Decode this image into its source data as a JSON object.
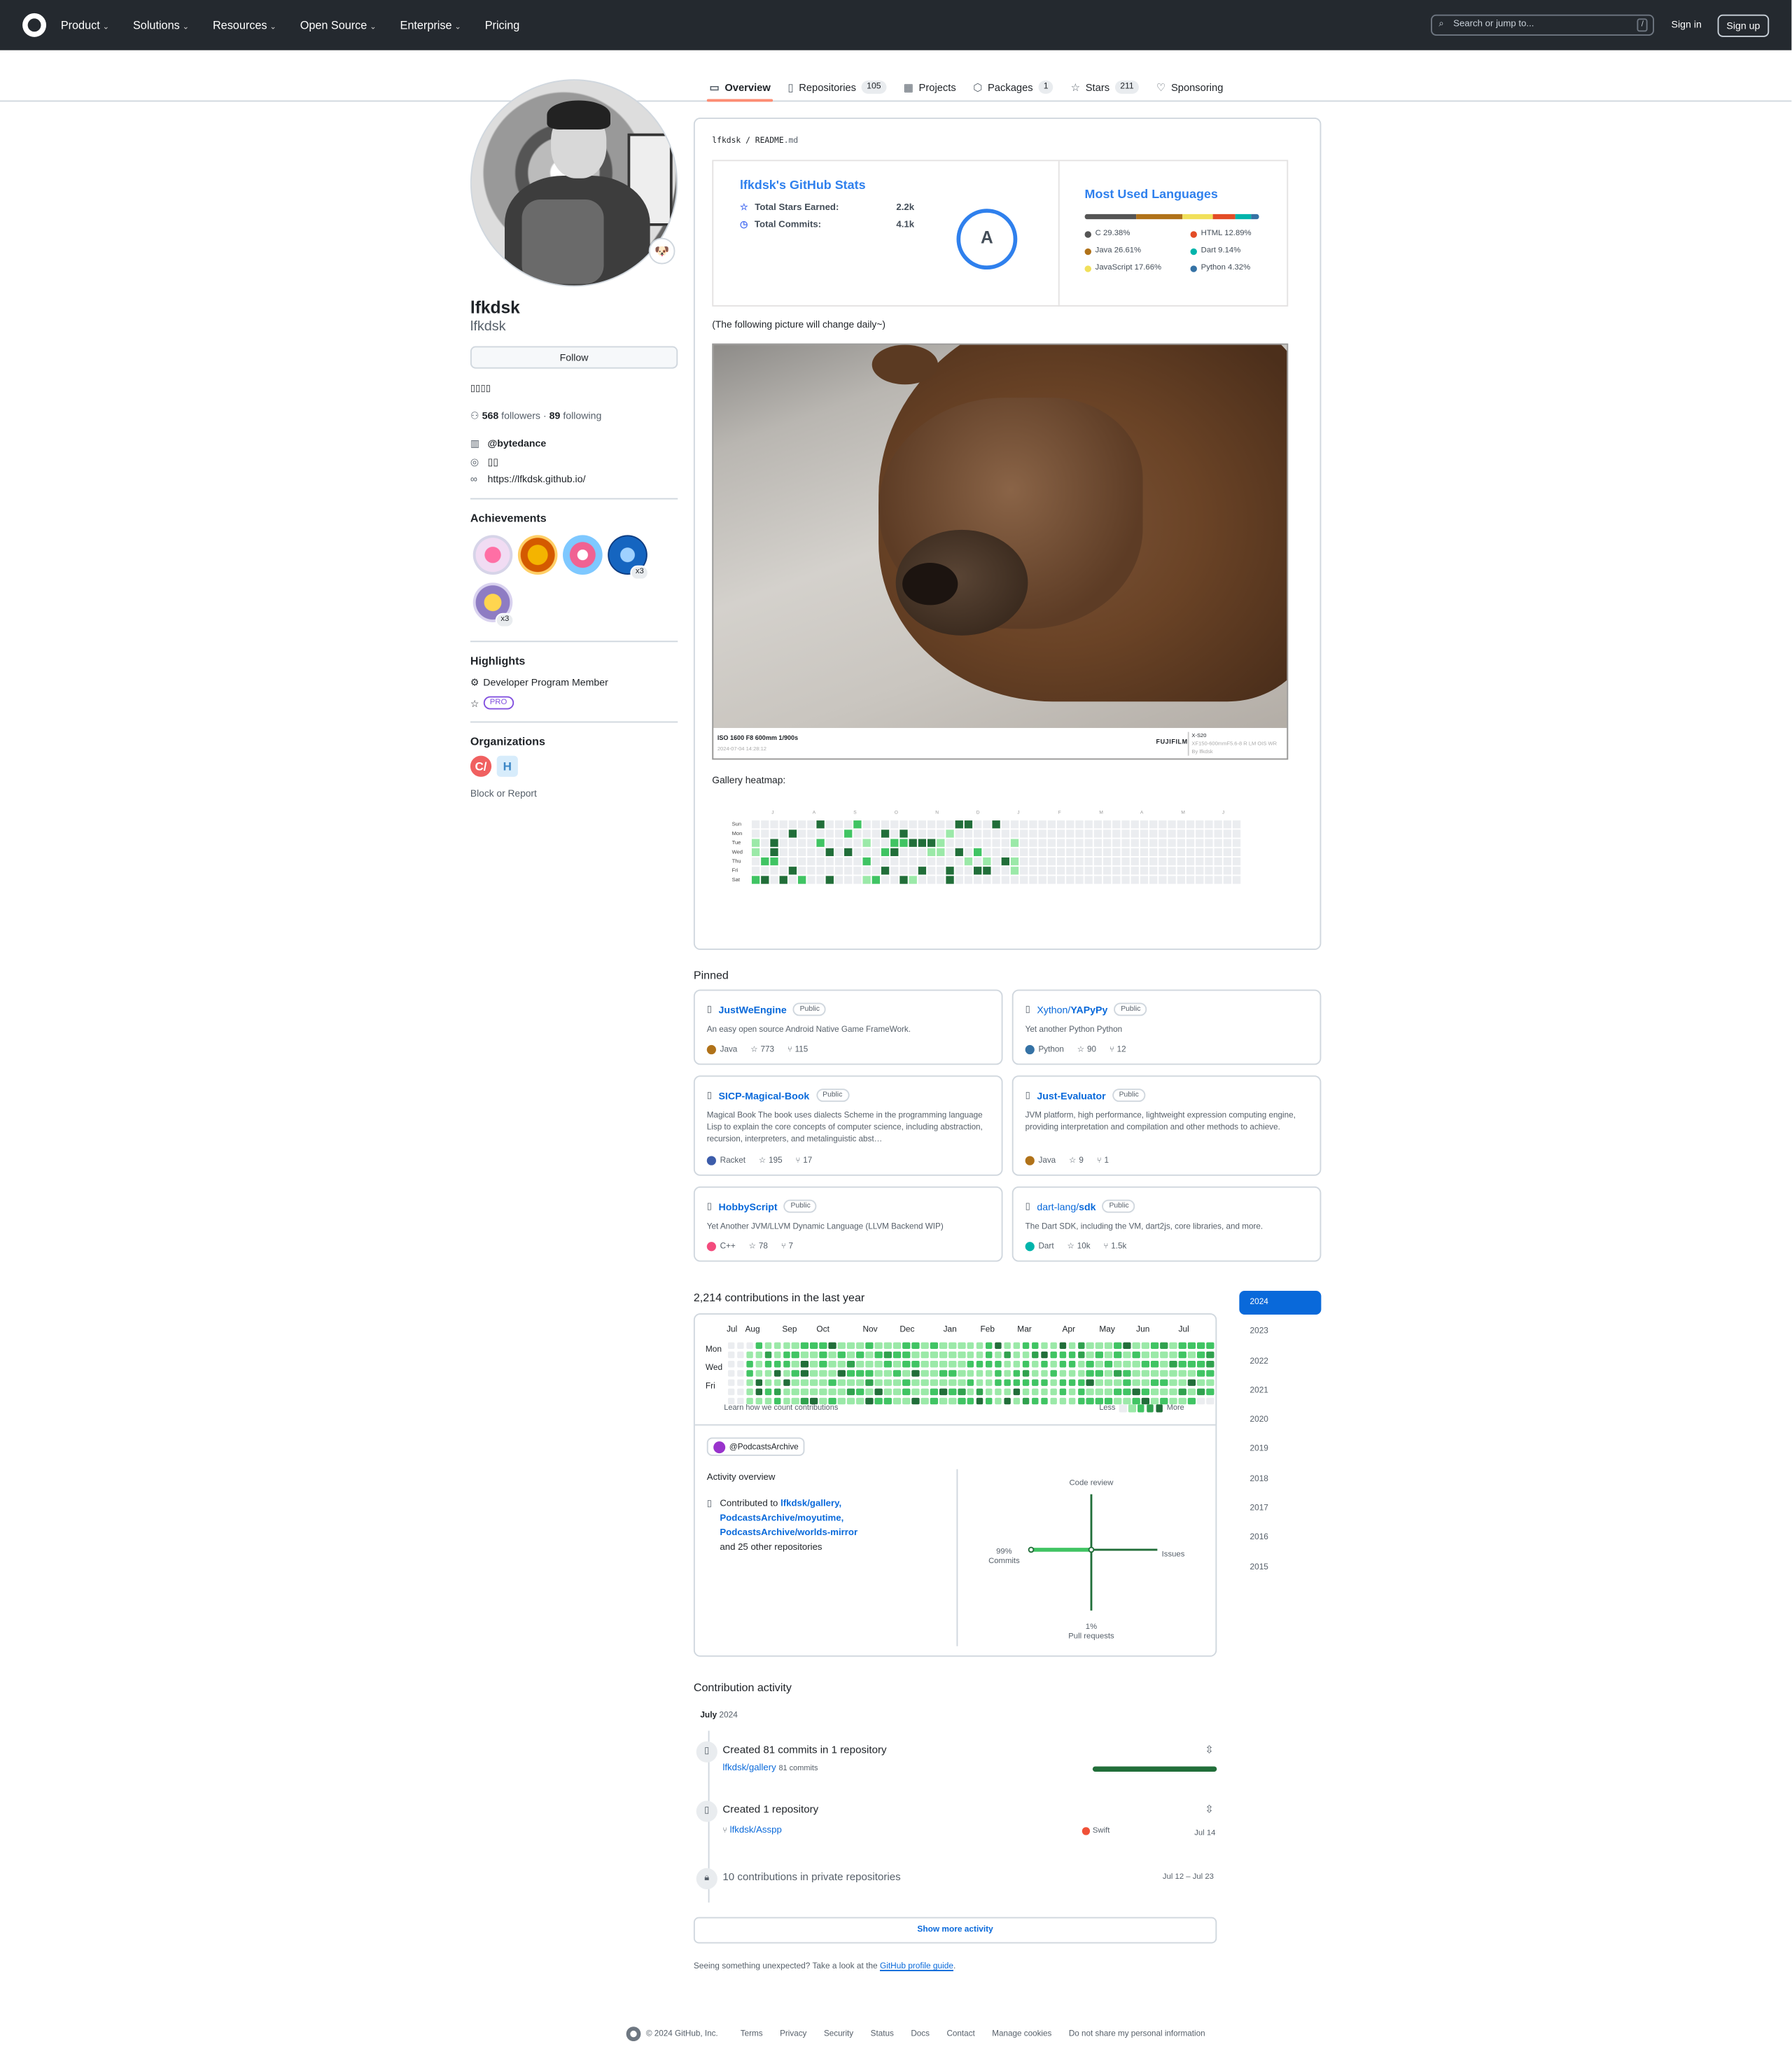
{
  "header": {
    "nav": [
      "Product",
      "Solutions",
      "Resources",
      "Open Source",
      "Enterprise",
      "Pricing"
    ],
    "search_placeholder": "Search or jump to...",
    "search_key": "/",
    "signin": "Sign in",
    "signup": "Sign up"
  },
  "tabs": [
    {
      "label": "Overview",
      "count": "",
      "icon": "book-icon"
    },
    {
      "label": "Repositories",
      "count": "105",
      "icon": "repo-icon"
    },
    {
      "label": "Projects",
      "count": "",
      "icon": "table-icon"
    },
    {
      "label": "Packages",
      "count": "1",
      "icon": "package-icon"
    },
    {
      "label": "Stars",
      "count": "211",
      "icon": "star-icon"
    },
    {
      "label": "Sponsoring",
      "count": "",
      "icon": "heart-icon"
    }
  ],
  "profile": {
    "name": "lfkdsk",
    "login": "lfkdsk",
    "follow": "Follow",
    "bio": "▯▯▯▯",
    "followers": "568",
    "followers_label": "followers",
    "sep": "·",
    "following": "89",
    "following_label": "following",
    "company": "@bytedance",
    "location": "▯▯",
    "website": "https://lfkdsk.github.io/",
    "status_emoji": "🐶"
  },
  "sidebar": {
    "achievements_title": "Achievements",
    "badge_counts": [
      "x3",
      "x3"
    ],
    "highlights_title": "Highlights",
    "highlight_member": "Developer Program Member",
    "highlight_pro": "PRO",
    "orgs_title": "Organizations",
    "orgs": [
      "C/",
      "H"
    ],
    "block": "Block or Report"
  },
  "readme": {
    "path_user": "lfkdsk",
    "path_sep": "/",
    "path_file": "README",
    "path_ext": ".md",
    "stats_title": "lfkdsk's GitHub Stats",
    "stars_label": "Total Stars Earned:",
    "stars_value": "2.2k",
    "commits_label": "Total Commits:",
    "commits_value": "4.1k",
    "grade": "A",
    "langs_title": "Most Used Languages",
    "langs": [
      {
        "name": "C 29.38%",
        "color": "#555555",
        "pct": 29.38
      },
      {
        "name": "Java 26.61%",
        "color": "#b07219",
        "pct": 26.61
      },
      {
        "name": "JavaScript 17.66%",
        "color": "#f1e05a",
        "pct": 17.66
      },
      {
        "name": "HTML 12.89%",
        "color": "#e34c26",
        "pct": 12.89
      },
      {
        "name": "Dart 9.14%",
        "color": "#00b4ab",
        "pct": 9.14
      },
      {
        "name": "Python 4.32%",
        "color": "#3572a5",
        "pct": 4.32
      }
    ],
    "caption": "(The following picture will change daily~)",
    "exif_main": "ISO 1600 F8 600mm 1/900s",
    "exif_date": "2024-07-04 14:28:12",
    "brand": "FUJIFILM",
    "cam1": "X-S20",
    "cam2": "XF150-600mmF5.6-8 R LM OIS WR",
    "cam3": "By lfkdsk",
    "gallery_title": "Gallery heatmap:",
    "gallery_days": [
      "Sun",
      "Mon",
      "Tue",
      "Wed",
      "Thu",
      "Fri",
      "Sat"
    ],
    "gallery_months": [
      "J",
      "A",
      "S",
      "O",
      "N",
      "D",
      "J",
      "F",
      "M",
      "A",
      "M",
      "J"
    ]
  },
  "pinned": {
    "title": "Pinned",
    "public": "Public",
    "items": [
      {
        "owner": "",
        "repo": "JustWeEngine",
        "desc": "An easy open source Android Native Game FrameWork.",
        "lang": "Java",
        "color": "#b07219",
        "stars": "773",
        "forks": "115"
      },
      {
        "owner": "Xython/",
        "repo": "YAPyPy",
        "desc": "Yet another Python Python",
        "lang": "Python",
        "color": "#3572a5",
        "stars": "90",
        "forks": "12"
      },
      {
        "owner": "",
        "repo": "SICP-Magical-Book",
        "desc": "Magical Book The book uses dialects Scheme in the programming language Lisp to explain the core concepts of computer science, including abstraction, recursion, interpreters, and metalinguistic abst…",
        "lang": "Racket",
        "color": "#3c5caa",
        "stars": "195",
        "forks": "17"
      },
      {
        "owner": "",
        "repo": "Just-Evaluator",
        "desc": "JVM platform, high performance, lightweight expression computing engine, providing interpretation and compilation and other methods to achieve.",
        "lang": "Java",
        "color": "#b07219",
        "stars": "9",
        "forks": "1"
      },
      {
        "owner": "",
        "repo": "HobbyScript",
        "desc": "Yet Another JVM/LLVM Dynamic Language (LLVM Backend WIP)",
        "lang": "C++",
        "color": "#f34b7d",
        "stars": "78",
        "forks": "7"
      },
      {
        "owner": "dart-lang/",
        "repo": "sdk",
        "desc": "The Dart SDK, including the VM, dart2js, core libraries, and more.",
        "lang": "Dart",
        "color": "#00b4ab",
        "stars": "10k",
        "forks": "1.5k"
      }
    ]
  },
  "contributions": {
    "title": "2,214 contributions in the last year",
    "months": [
      "Jul",
      "Aug",
      "Sep",
      "Oct",
      "Nov",
      "Dec",
      "Jan",
      "Feb",
      "Mar",
      "Apr",
      "May",
      "Jun",
      "Jul"
    ],
    "days": [
      "Mon",
      "Wed",
      "Fri"
    ],
    "learn": "Learn how we count contributions",
    "less": "Less",
    "more": "More",
    "level_colors": [
      "#ebedf0",
      "#9be9a8",
      "#40c463",
      "#30a14e",
      "#216e39"
    ],
    "org": "@PodcastsArchive",
    "overview_title": "Activity overview",
    "contributed_to": "Contributed to",
    "repos": [
      "lfkdsk/gallery,",
      "PodcastsArchive/moyutime,",
      "PodcastsArchive/worlds-mirror"
    ],
    "others": "and 25 other repositories",
    "axis": {
      "top": "Code review",
      "left_pct": "99%",
      "left": "Commits",
      "right": "Issues",
      "bottom_pct": "1%",
      "bottom": "Pull requests"
    },
    "commits_share": 0.99,
    "pr_share": 0.01
  },
  "years": [
    "2024",
    "2023",
    "2022",
    "2021",
    "2020",
    "2019",
    "2018",
    "2017",
    "2016",
    "2015"
  ],
  "activity": {
    "title": "Contribution activity",
    "month": "July",
    "year": "2024",
    "ev1_title": "Created 81 commits in 1 repository",
    "ev1_repo": "lfkdsk/gallery",
    "ev1_count": "81 commits",
    "ev2_title": "Created 1 repository",
    "ev2_repo": "lfkdsk/Asspp",
    "ev2_lang": "Swift",
    "ev2_date": "Jul 14",
    "ev3_title": "10 contributions in private repositories",
    "ev3_date": "Jul 12 – Jul 23",
    "show_more": "Show more activity",
    "unexpected": "Seeing something unexpected? Take a look at the",
    "guide": "GitHub profile guide",
    "period": "."
  },
  "footer": [
    "© 2024 GitHub, Inc.",
    "Terms",
    "Privacy",
    "Security",
    "Status",
    "Docs",
    "Contact",
    "Manage cookies",
    "Do not share my personal information"
  ]
}
